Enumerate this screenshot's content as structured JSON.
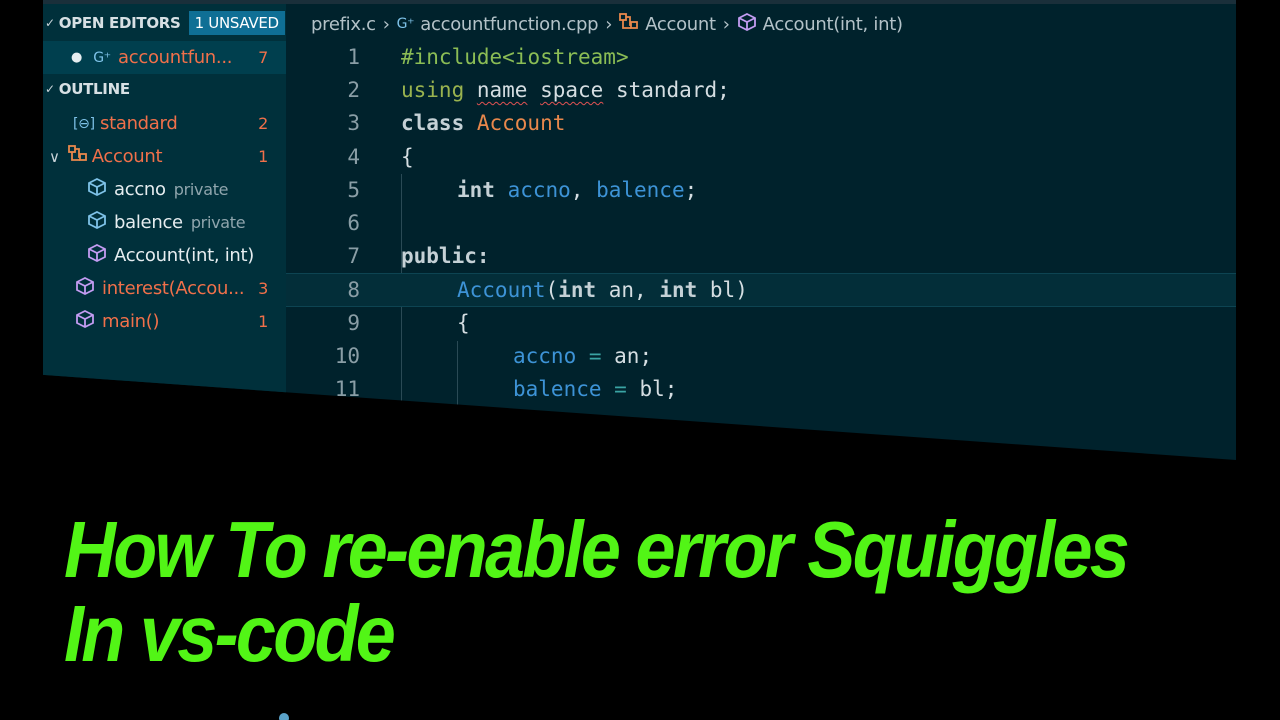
{
  "sidebar": {
    "open_editors": {
      "label": "OPEN EDITORS",
      "badge": "1 UNSAVED",
      "file": {
        "name": "accountfun...",
        "count": "7"
      }
    },
    "outline": {
      "label": "OUTLINE",
      "items": [
        {
          "label": "standard",
          "count": "2",
          "icon": "namespace-icon"
        },
        {
          "label": "Account",
          "count": "1",
          "icon": "class-icon"
        },
        {
          "label": "accno",
          "detail": "private",
          "icon": "field-icon"
        },
        {
          "label": "balence",
          "detail": "private",
          "icon": "field-icon"
        },
        {
          "label": "Account(int, int)",
          "icon": "method-icon"
        },
        {
          "label": "interest(Accou...",
          "count": "3",
          "icon": "method-icon"
        },
        {
          "label": "main()",
          "count": "1",
          "icon": "method-icon"
        }
      ]
    }
  },
  "breadcrumb": {
    "items": [
      "prefix.c",
      "accountfunction.cpp",
      "Account",
      "Account(int, int)"
    ]
  },
  "code": {
    "line_numbers": [
      "1",
      "2",
      "3",
      "4",
      "5",
      "6",
      "7",
      "8",
      "9",
      "10",
      "11"
    ],
    "l1": {
      "a": "#include",
      "b": "<iostream>"
    },
    "l2": {
      "a": "using",
      "b": "name",
      "c": "space",
      "d": " standard;"
    },
    "l3": {
      "a": "class ",
      "b": "Account"
    },
    "l4": "{",
    "l5": {
      "a": "int ",
      "b": "accno",
      "c": ", ",
      "d": "balence",
      "e": ";"
    },
    "l7": "public:",
    "l8": {
      "a": "Account",
      "b": "(",
      "c": "int",
      "d": " an, ",
      "e": "int",
      "f": " bl)"
    },
    "l9": "{",
    "l10": {
      "a": "accno",
      "b": " = ",
      "c": "an;"
    },
    "l11": {
      "a": "balence",
      "b": " = ",
      "c": "bl;"
    }
  },
  "title": {
    "line1": "How To re-enable error Squiggles",
    "line2": "In vs-code"
  },
  "colors": {
    "title": "#52f516",
    "editor_bg": "#00222c",
    "sidebar_bg": "#00303b",
    "badge_bg": "#0f6f95",
    "squiggle": "#e05252"
  }
}
